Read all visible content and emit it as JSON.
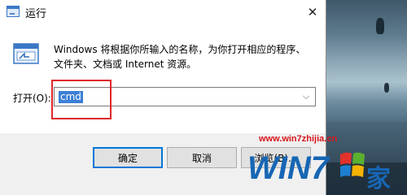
{
  "window": {
    "title": "运行",
    "close_icon": "close-icon",
    "app_icon": "run-app-icon"
  },
  "content": {
    "description_line1": "Windows 将根据你所输入的名称，为你打开相应的程序、",
    "description_line2": "文件夹、文档或 Internet 资源。",
    "open_label": "打开(O):",
    "open_value": "cmd"
  },
  "buttons": {
    "ok": "确定",
    "cancel": "取消",
    "browse": "浏览(B)..."
  },
  "watermark": {
    "url": "www.win7zhijia.cn",
    "logo_text": "WIN7",
    "logo_char": "家"
  },
  "colors": {
    "selection": "#3b7fd6",
    "highlight_box": "#e0262a",
    "watermark_red": "#d9141b",
    "watermark_blue": "#1766b4"
  }
}
